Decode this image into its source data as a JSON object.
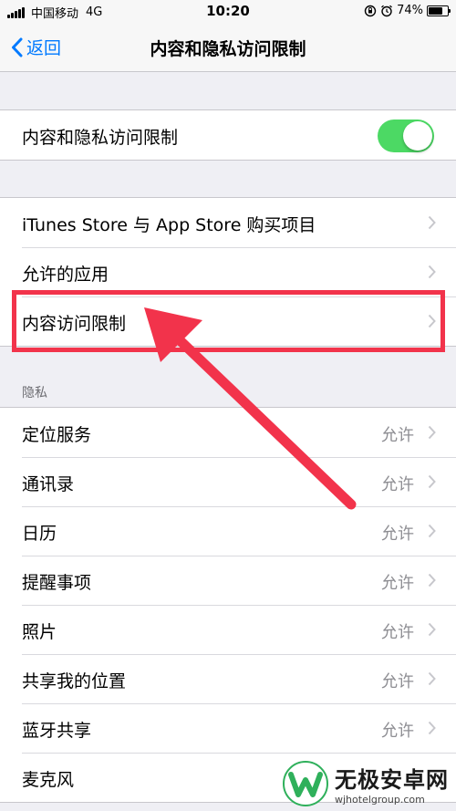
{
  "status_bar": {
    "carrier": "中国移动",
    "network": "4G",
    "time": "10:20",
    "battery_text": "74%",
    "battery_level": 0.74
  },
  "nav": {
    "back_label": "返回",
    "title": "内容和隐私访问限制"
  },
  "toggle_row": {
    "label": "内容和隐私访问限制",
    "enabled": true
  },
  "menu_group": [
    {
      "label": "iTunes Store 与 App Store 购买项目"
    },
    {
      "label": "允许的应用"
    },
    {
      "label": "内容访问限制"
    }
  ],
  "privacy": {
    "header": "隐私",
    "items": [
      {
        "label": "定位服务",
        "value": "允许"
      },
      {
        "label": "通讯录",
        "value": "允许"
      },
      {
        "label": "日历",
        "value": "允许"
      },
      {
        "label": "提醒事项",
        "value": "允许"
      },
      {
        "label": "照片",
        "value": "允许"
      },
      {
        "label": "共享我的位置",
        "value": "允许"
      },
      {
        "label": "蓝牙共享",
        "value": "允许"
      },
      {
        "label": "麦克风",
        "value": ""
      }
    ]
  },
  "watermark": {
    "title": "无极安卓网",
    "url": "wjhotelgroup.com"
  },
  "colors": {
    "accent": "#007aff",
    "toggle_on": "#4cd964",
    "annotation": "#f2334b",
    "watermark_green": "#2fb05b"
  }
}
